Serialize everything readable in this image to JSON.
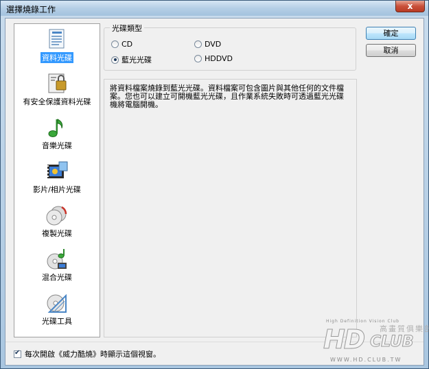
{
  "window": {
    "title": "選擇燒錄工作",
    "close_glyph": "x"
  },
  "sidebar": {
    "items": [
      {
        "label": "資料光碟",
        "icon": "data-disc-icon",
        "selected": true
      },
      {
        "label": "有安全保護資料光碟",
        "icon": "secure-data-disc-icon",
        "selected": false
      },
      {
        "label": "音樂光碟",
        "icon": "music-note-icon",
        "selected": false
      },
      {
        "label": "影片/相片光碟",
        "icon": "film-photo-icon",
        "selected": false
      },
      {
        "label": "複製光碟",
        "icon": "copy-disc-icon",
        "selected": false
      },
      {
        "label": "混合光碟",
        "icon": "mixed-disc-icon",
        "selected": false
      },
      {
        "label": "光碟工具",
        "icon": "disc-tools-icon",
        "selected": false
      }
    ]
  },
  "disc_type": {
    "legend": "光碟類型",
    "options": [
      {
        "label": "CD",
        "checked": false
      },
      {
        "label": "DVD",
        "checked": false
      },
      {
        "label": "藍光光碟",
        "checked": true
      },
      {
        "label": "HDDVD",
        "checked": false
      }
    ]
  },
  "description": "將資料檔案燒錄到藍光光碟。資料檔案可包含圖片與其他任何的文件檔案。您也可以建立可開機藍光光碟，且作業系統失敗時可透過藍光光碟機將電腦開機。",
  "buttons": {
    "ok": "確定",
    "cancel": "取消"
  },
  "footer": {
    "show_on_start_label": "每次開啟《威力酷燒》時顯示這個視窗。",
    "show_on_start_checked": true
  },
  "watermark": {
    "tagline": "High Definition Vision Club",
    "logo_main": "HD",
    "logo_club": "CLUB",
    "chinese": "高畫質俱樂部",
    "url": "WWW.HD.CLUB.TW"
  },
  "colors": {
    "selection": "#3399ff",
    "title_bar": "#b5cfe6",
    "close_button": "#c9503a"
  }
}
